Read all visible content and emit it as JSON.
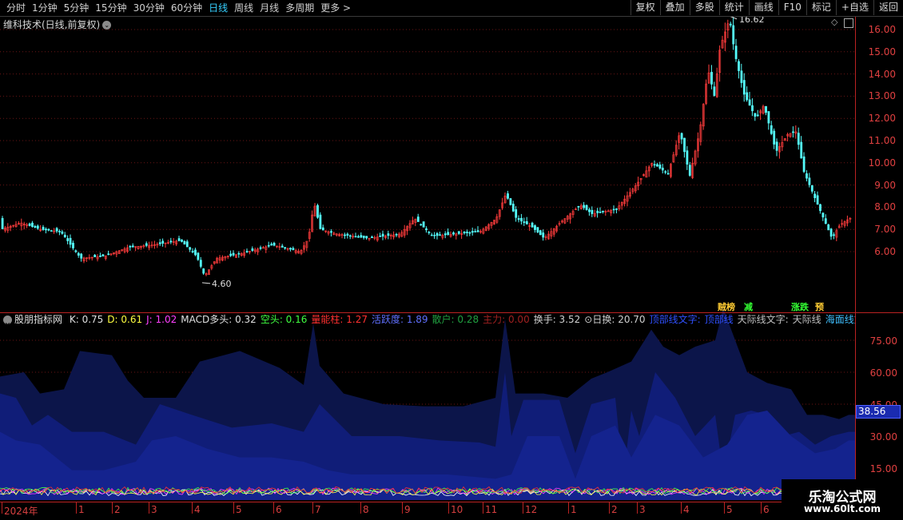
{
  "toolbar": {
    "periods": [
      "分时",
      "1分钟",
      "5分钟",
      "15分钟",
      "30分钟",
      "60分钟",
      "日线",
      "周线",
      "月线",
      "多周期",
      "更多 >"
    ],
    "active_period": "日线",
    "actions": [
      "复权",
      "叠加",
      "多股",
      "统计",
      "画线",
      "F10",
      "标记",
      "+自选",
      "返回"
    ]
  },
  "stock": {
    "title": "维科技术(日线,前复权)",
    "high_label": "16.62",
    "low_label": "4.60"
  },
  "price_axis": [
    "16.00",
    "15.00",
    "14.00",
    "13.00",
    "12.00",
    "11.00",
    "10.00",
    "9.00",
    "8.00",
    "7.00",
    "6.00"
  ],
  "signals": [
    {
      "text": "贼榜",
      "color": "#ffcc33"
    },
    {
      "text": "减",
      "color": "#33ff33"
    },
    {
      "text": "涨跌",
      "color": "#33ff33"
    },
    {
      "text": "预",
      "color": "#ffcc33"
    }
  ],
  "indicator": {
    "name": "股朋指标网",
    "items": [
      {
        "label": "K: 0.75",
        "color": "#e0e0e0"
      },
      {
        "label": "D: 0.61",
        "color": "#ffff40"
      },
      {
        "label": "J: 1.02",
        "color": "#ff40ff"
      },
      {
        "label": "MACD多头: 0.32",
        "color": "#e0e0e0"
      },
      {
        "label": "空头: 0.16",
        "color": "#40ff40"
      },
      {
        "label": "量能柱: 1.27",
        "color": "#ff3030"
      },
      {
        "label": "活跃度: 1.89",
        "color": "#6070ff"
      },
      {
        "label": "散户: 0.28",
        "color": "#20a040"
      },
      {
        "label": "主力: 0.00",
        "color": "#a02020"
      },
      {
        "label": "换手: 3.52",
        "color": "#d0d0d0"
      },
      {
        "label": "⊙日换: 20.70",
        "color": "#d0d0d0"
      },
      {
        "label": "顶部线文字:",
        "color": "#3050ff"
      },
      {
        "label": "顶部线",
        "color": "#3050ff"
      },
      {
        "label": "天际线文字:",
        "color": "#c0c0c0"
      },
      {
        "label": "天际线",
        "color": "#c0c0c0"
      },
      {
        "label": "海面线文字:",
        "color": "#40c0ff"
      },
      {
        "label": "海面",
        "color": "#40c0ff"
      }
    ],
    "axis": [
      "75.00",
      "60.00",
      "45.00",
      "30.00",
      "15.00"
    ],
    "current_value": "38.56"
  },
  "dates": [
    "2024年",
    "1",
    "2",
    "3",
    "4",
    "5",
    "6",
    "7",
    "8",
    "9",
    "10",
    "11",
    "12",
    "1",
    "2",
    "3",
    "4",
    "5",
    "6"
  ],
  "watermark": {
    "line1": "乐淘公式网",
    "line2": "www.60lt.com"
  }
}
